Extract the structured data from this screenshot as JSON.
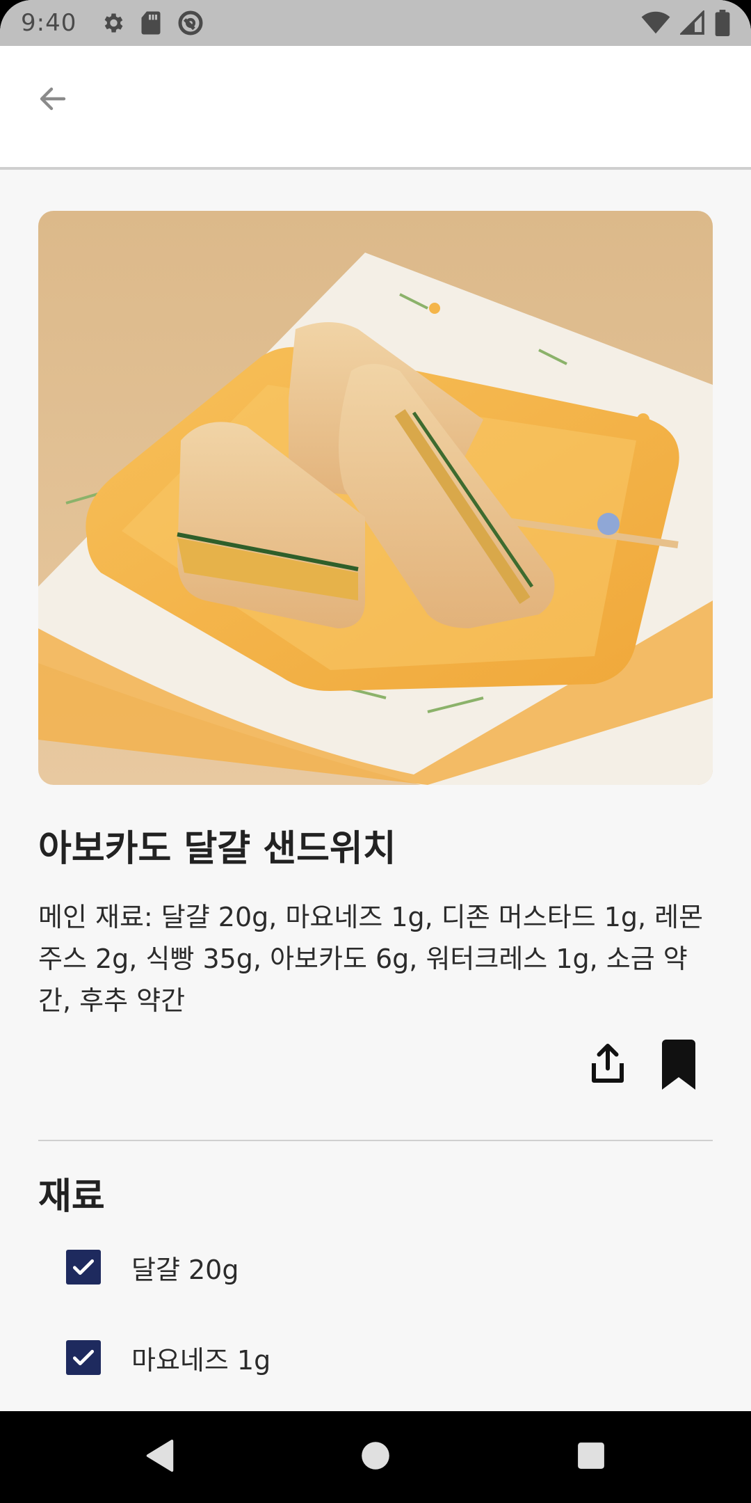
{
  "status_bar": {
    "time": "9:40",
    "left_icons": [
      "gear-icon",
      "sd-card-icon",
      "sync-circle-icon"
    ],
    "right_icons": [
      "wifi-icon",
      "signal-icon",
      "battery-icon"
    ]
  },
  "app_bar": {
    "back_icon": "arrow-left-icon"
  },
  "recipe": {
    "image_alt": "sandwich-photo",
    "title": "아보카도 달걀 샌드위치",
    "description": "메인 재료: 달걀 20g, 마요네즈 1g, 디존 머스타드 1g, 레몬주스 2g, 식빵 35g, 아보카도 6g, 워터크레스 1g, 소금 약간, 후추 약간",
    "actions": [
      "share-icon",
      "bookmark-icon"
    ]
  },
  "ingredients_section": {
    "title": "재료",
    "items": [
      {
        "label": "달걀 20g",
        "checked": true
      },
      {
        "label": "마요네즈 1g",
        "checked": true
      }
    ]
  },
  "colors": {
    "checkbox": "#1e2a5e",
    "background": "#f7f7f7",
    "status_bar": "#bfbfbf"
  },
  "nav_bar": {
    "buttons": [
      "back-triangle-icon",
      "home-circle-icon",
      "recents-square-icon"
    ]
  }
}
